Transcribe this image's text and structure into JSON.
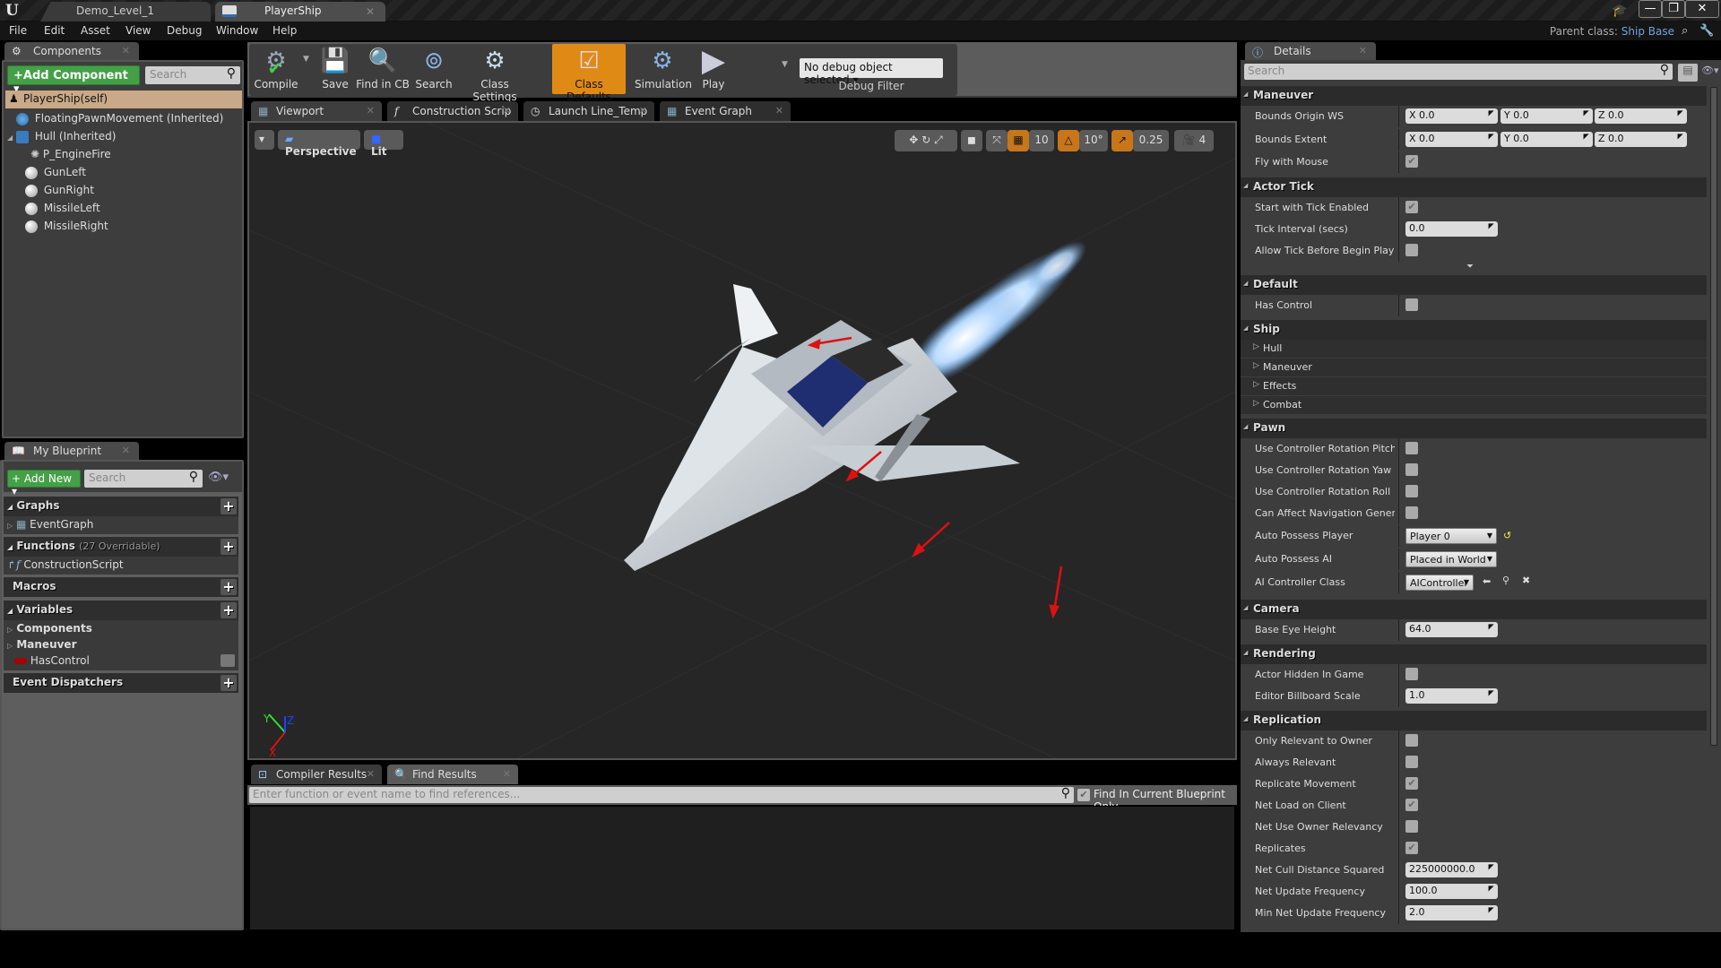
{
  "window": {
    "tabs": [
      {
        "label": "Demo_Level_1"
      },
      {
        "label": "PlayerShip"
      }
    ],
    "controls": {
      "minimize": "—",
      "restore": "❐",
      "close": "✕"
    }
  },
  "menu": {
    "items": [
      "File",
      "Edit",
      "Asset",
      "View",
      "Debug",
      "Window",
      "Help"
    ],
    "parent_class_label": "Parent class:",
    "parent_class_value": "Ship Base"
  },
  "components": {
    "tab_label": "Components",
    "add_button": "+Add Component",
    "search_placeholder": "Search",
    "items": [
      {
        "label": "PlayerShip(self)",
        "indent": 0,
        "selected": true,
        "icon": "pawn-icon"
      },
      {
        "label": "FloatingPawnMovement (Inherited)",
        "indent": 1,
        "icon": "movement-icon"
      },
      {
        "label": "Hull (Inherited)",
        "indent": 1,
        "icon": "static-mesh-icon",
        "expanded": true
      },
      {
        "label": "P_EngineFire",
        "indent": 2,
        "icon": "particle-icon"
      },
      {
        "label": "GunLeft",
        "indent": 2,
        "icon": "scene-component-icon"
      },
      {
        "label": "GunRight",
        "indent": 2,
        "icon": "scene-component-icon"
      },
      {
        "label": "MissileLeft",
        "indent": 2,
        "icon": "scene-component-icon"
      },
      {
        "label": "MissileRight",
        "indent": 2,
        "icon": "scene-component-icon"
      }
    ]
  },
  "my_blueprint": {
    "tab_label": "My Blueprint",
    "add_button": "+ Add New",
    "search_placeholder": "Search",
    "sections": {
      "graphs": "Graphs",
      "graphs_items": [
        "EventGraph"
      ],
      "functions": "Functions",
      "functions_note": "(27 Overridable)",
      "functions_items": [
        "ConstructionScript"
      ],
      "macros": "Macros",
      "variables": "Variables",
      "variables_groups": [
        "Components",
        "Maneuver"
      ],
      "variables_items": [
        "HasControl"
      ],
      "dispatchers": "Event Dispatchers"
    }
  },
  "toolbar": {
    "buttons": [
      {
        "label": "Compile"
      },
      {
        "label": "Save"
      },
      {
        "label": "Find in CB"
      },
      {
        "label": "Search"
      },
      {
        "label": "Class Settings"
      },
      {
        "label": "Class Defaults",
        "active": true
      },
      {
        "label": "Simulation"
      },
      {
        "label": "Play"
      }
    ],
    "debug_select": "No debug object selected",
    "debug_label": "Debug Filter"
  },
  "graph_tabs": [
    {
      "label": "Viewport",
      "active": true
    },
    {
      "label": "Construction Scrip"
    },
    {
      "label": "Launch Line_Temp"
    },
    {
      "label": "Event Graph"
    }
  ],
  "viewport": {
    "view_mode": "Perspective",
    "lighting": "Lit",
    "grid_snap": "10",
    "rotation_snap": "10°",
    "scale_snap": "0.25",
    "camera_speed": "4",
    "axis_labels": {
      "x": "X",
      "y": "Y",
      "z": "Z"
    }
  },
  "bottom": {
    "tabs": [
      {
        "label": "Compiler Results"
      },
      {
        "label": "Find Results",
        "active": true
      }
    ],
    "find_placeholder": "Enter function or event name to find references...",
    "find_option": "Find In Current Blueprint Only",
    "find_option_checked": true
  },
  "details": {
    "tab_label": "Details",
    "search_placeholder": "Search",
    "maneuver": {
      "title": "Maneuver",
      "bounds_origin_label": "Bounds Origin WS",
      "bounds_origin": {
        "x": "0.0",
        "y": "0.0",
        "z": "0.0"
      },
      "bounds_extent_label": "Bounds Extent",
      "bounds_extent": {
        "x": "0.0",
        "y": "0.0",
        "z": "0.0"
      },
      "fly_with_mouse_label": "Fly with Mouse",
      "fly_with_mouse": true
    },
    "actor_tick": {
      "title": "Actor Tick",
      "start_tick_label": "Start with Tick Enabled",
      "start_tick": true,
      "tick_interval_label": "Tick Interval (secs)",
      "tick_interval": "0.0",
      "allow_tick_label": "Allow Tick Before Begin Play",
      "allow_tick": false
    },
    "default": {
      "title": "Default",
      "has_control_label": "Has Control",
      "has_control": false
    },
    "ship": {
      "title": "Ship",
      "groups": [
        "Hull",
        "Maneuver",
        "Effects",
        "Combat"
      ]
    },
    "pawn": {
      "title": "Pawn",
      "pitch_label": "Use Controller Rotation Pitch",
      "yaw_label": "Use Controller Rotation Yaw",
      "roll_label": "Use Controller Rotation Roll",
      "nav_label": "Can Affect Navigation Generation",
      "auto_player_label": "Auto Possess Player",
      "auto_player": "Player 0",
      "auto_ai_label": "Auto Possess AI",
      "auto_ai": "Placed in World",
      "ai_class_label": "AI Controller Class",
      "ai_class": "AIController"
    },
    "camera": {
      "title": "Camera",
      "eye_height_label": "Base Eye Height",
      "eye_height": "64.0"
    },
    "rendering": {
      "title": "Rendering",
      "hidden_label": "Actor Hidden In Game",
      "billboard_label": "Editor Billboard Scale",
      "billboard": "1.0"
    },
    "replication": {
      "title": "Replication",
      "only_owner_label": "Only Relevant to Owner",
      "always_label": "Always Relevant",
      "rep_movement_label": "Replicate Movement",
      "net_load_label": "Net Load on Client",
      "owner_rel_label": "Net Use Owner Relevancy",
      "replicates_label": "Replicates",
      "cull_label": "Net Cull Distance Squared",
      "cull": "225000000.0",
      "freq_label": "Net Update Frequency",
      "freq": "100.0",
      "min_freq_label": "Min Net Update Frequency",
      "min_freq": "2.0"
    }
  }
}
